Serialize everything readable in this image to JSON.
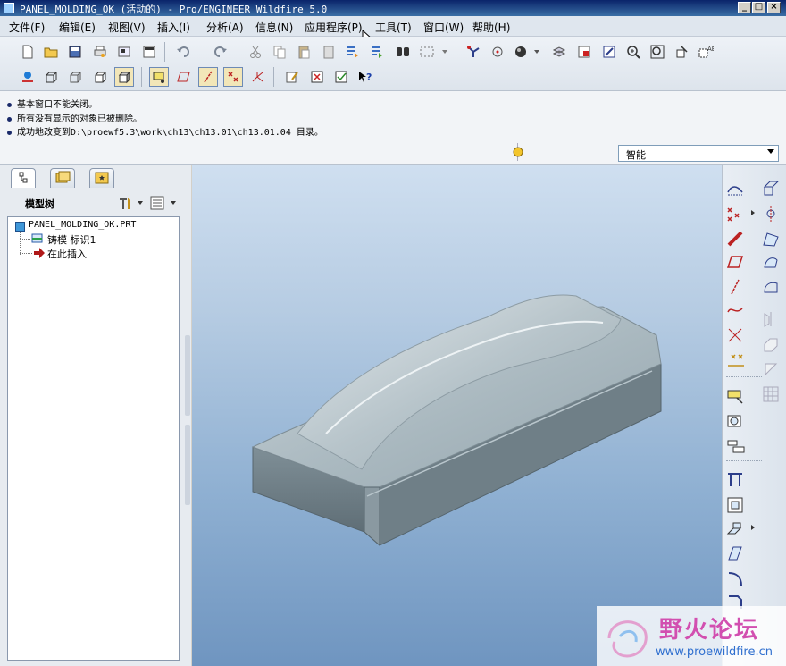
{
  "window": {
    "title": "PANEL_MOLDING_OK (活动的) - Pro/ENGINEER Wildfire 5.0"
  },
  "menubar": {
    "items": [
      "文件(F)",
      "编辑(E)",
      "视图(V)",
      "插入(I)",
      "分析(A)",
      "信息(N)",
      "应用程序(P)",
      "工具(T)",
      "窗口(W)",
      "帮助(H)"
    ]
  },
  "messages": [
    "基本窗口不能关闭。",
    "所有没有显示的对象已被删除。",
    "成功地改变到D:\\proewf5.3\\work\\ch13\\ch13.01\\ch13.01.04 目录。"
  ],
  "filter": {
    "value": "智能"
  },
  "model_tree": {
    "title": "模型树",
    "items": [
      {
        "label": "PANEL_MOLDING_OK.PRT",
        "icon": "part-icon"
      },
      {
        "label": "铸模 标识1",
        "icon": "mold-feature-icon"
      },
      {
        "label": "在此插入",
        "icon": "insert-here-arrow-icon"
      }
    ]
  },
  "watermark": {
    "text_cn": "野火论坛",
    "url": "www.proewildfire.cn"
  },
  "colors": {
    "title_bar": "#0a246a",
    "graphics_top": "#cfdff0",
    "graphics_bottom": "#6f95c0",
    "model": "#a3b3bb",
    "watermark_text": "#d24fb0",
    "url_text": "#2f6fcf"
  }
}
